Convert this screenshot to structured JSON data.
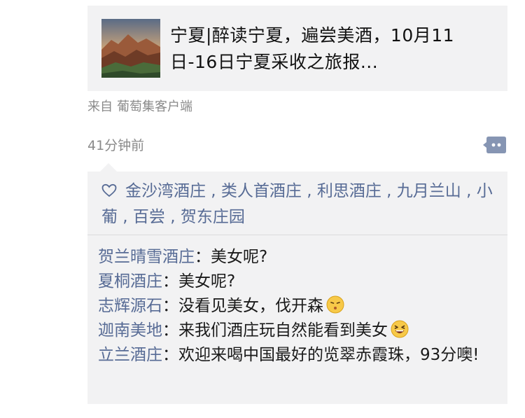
{
  "link_card": {
    "title": "宁夏|醉读宁夏，遍尝美酒，10月11日-16日宁夏采收之旅报..."
  },
  "source": {
    "prefix": "来自",
    "app_name": "葡萄集客户端"
  },
  "timestamp": "41分钟前",
  "likes": {
    "icon": "heart-icon",
    "names": "金沙湾酒庄 , 类人首酒庄 , 利思酒庄 , 九月兰山 , 小葡 , 百尝 , 贺东庄园"
  },
  "comments": [
    {
      "author": "贺兰晴雪酒庄",
      "sep": "：",
      "text": "美女呢?"
    },
    {
      "author": "夏桐酒庄",
      "sep": "：",
      "text": "美女呢?"
    },
    {
      "author": "志辉源石",
      "sep": "：",
      "text": "没看见美女，伐开森",
      "emoji": "pouting-face-emoji"
    },
    {
      "author": "迦南美地",
      "sep": "：",
      "text": "来我们酒庄玩自然能看到美女",
      "emoji": "grinning-squint-emoji"
    },
    {
      "author": "立兰酒庄",
      "sep": "：",
      "text": "欢迎来喝中国最好的览翠赤霞珠，93分噢!"
    }
  ],
  "colors": {
    "name_link": "#576b95",
    "card_bg": "#f2f2f3",
    "meta_gray": "#8a8a8a"
  }
}
